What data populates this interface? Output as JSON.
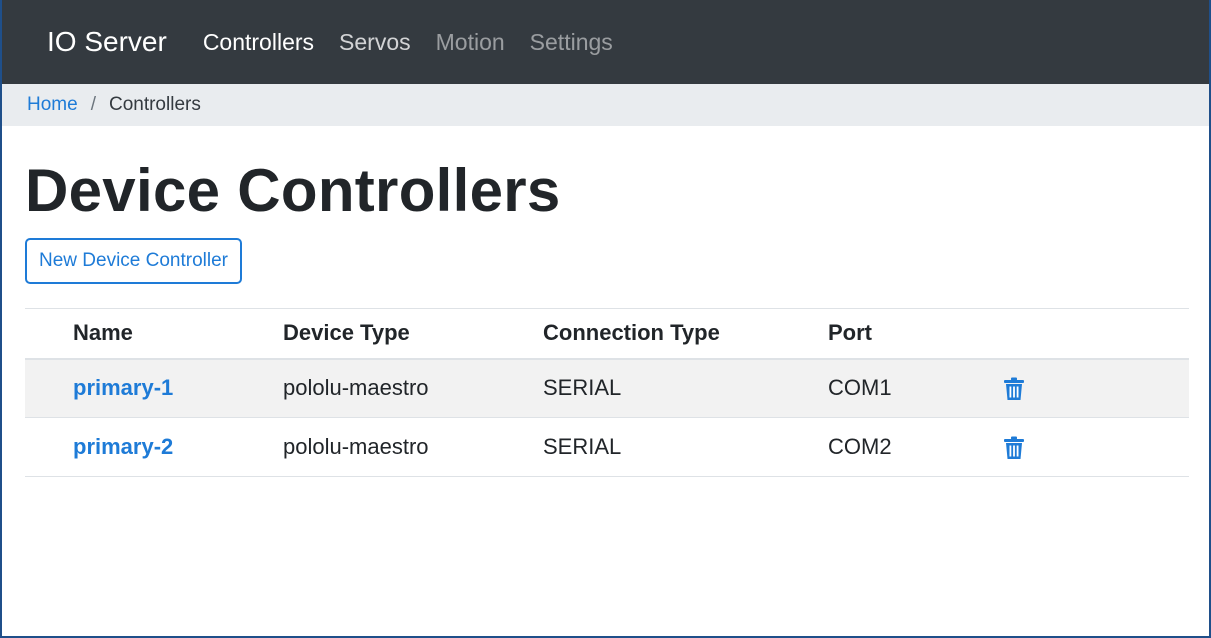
{
  "navbar": {
    "brand": "IO Server",
    "links": [
      {
        "label": "Controllers",
        "state": "active"
      },
      {
        "label": "Servos",
        "state": "normal"
      },
      {
        "label": "Motion",
        "state": "muted"
      },
      {
        "label": "Settings",
        "state": "muted"
      }
    ]
  },
  "breadcrumb": {
    "home": "Home",
    "separator": "/",
    "current": "Controllers"
  },
  "page": {
    "title": "Device Controllers",
    "new_button": "New Device Controller"
  },
  "table": {
    "headers": [
      "Name",
      "Device Type",
      "Connection Type",
      "Port"
    ],
    "rows": [
      {
        "name": "primary-1",
        "device_type": "pololu-maestro",
        "connection_type": "SERIAL",
        "port": "COM1",
        "action_icon": "trash-icon"
      },
      {
        "name": "primary-2",
        "device_type": "pololu-maestro",
        "connection_type": "SERIAL",
        "port": "COM2",
        "action_icon": "trash-icon"
      }
    ]
  },
  "colors": {
    "navbar_bg": "#343a40",
    "accent": "#1e7bd7",
    "breadcrumb_bg": "#e9ecef",
    "row_stripe": "#f2f2f2"
  }
}
